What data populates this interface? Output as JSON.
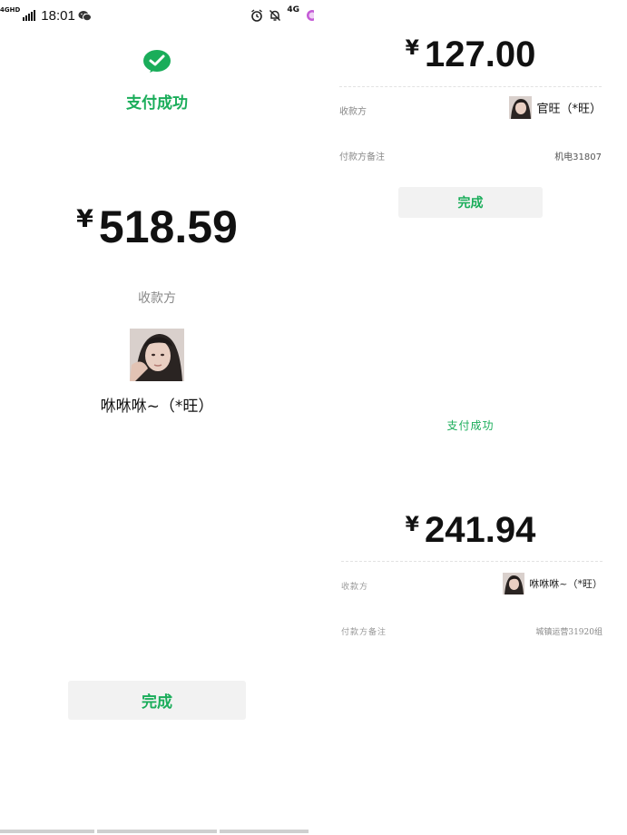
{
  "status_bar": {
    "network_label": "4GHD",
    "time": "18:01",
    "network_label_right": "4G"
  },
  "left_receipt": {
    "success_title": "支付成功",
    "currency_symbol": "¥",
    "amount": "518.59",
    "payee_label": "收款方",
    "payee_name": "咻咻咻~（*旺）",
    "done_button_label": "完成"
  },
  "right_top_receipt": {
    "currency_symbol": "¥",
    "amount": "127.00",
    "payee_label": "收款方",
    "payee_name": "官旺（*旺）",
    "remark_label": "付款方备注",
    "remark_value": "机电31807",
    "done_button_label": "完成"
  },
  "right_bottom_receipt": {
    "success_title": "支付成功",
    "currency_symbol": "¥",
    "amount": "241.94",
    "payee_label": "收款方",
    "payee_name": "咻咻咻~（*旺）",
    "remark_label": "付款方备注",
    "remark_value": "城镇运营31920组"
  },
  "colors": {
    "brand_green": "#1aad5a",
    "button_bg": "#f2f2f2",
    "muted_text": "#888888"
  },
  "icons": [
    "wechat-notification-icon",
    "alarm-icon",
    "mute-bell-icon",
    "signal-icon",
    "battery-icon",
    "success-check-icon",
    "avatar-photo"
  ]
}
